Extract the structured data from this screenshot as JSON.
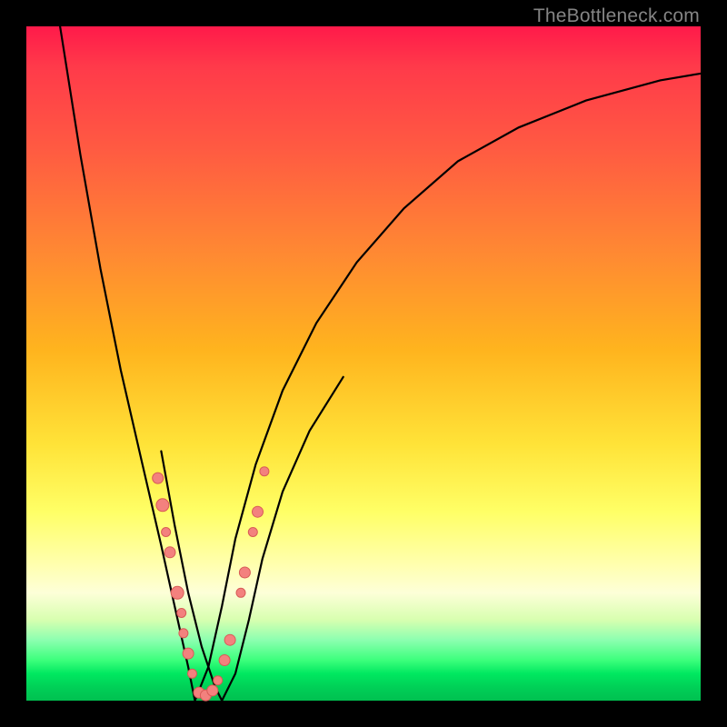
{
  "watermark": "TheBottleneck.com",
  "colors": {
    "border": "#000000",
    "curve": "#000000",
    "dot_fill": "#f3817e",
    "dot_stroke": "#d85b56"
  },
  "chart_data": {
    "type": "line",
    "title": "",
    "xlabel": "",
    "ylabel": "",
    "xlim": [
      0,
      100
    ],
    "ylim": [
      0,
      100
    ],
    "note": "Two V-shaped bottleneck curves on a red-to-green vertical gradient. Minima near x≈25 (main curve) and x≈29 (secondary curve). Axis values are estimated from pixel positions; the image has no tick labels.",
    "series": [
      {
        "name": "curve-main",
        "x": [
          5,
          8,
          11,
          14,
          17,
          20,
          22,
          24,
          25,
          27,
          29,
          31,
          34,
          38,
          43,
          49,
          56,
          64,
          73,
          83,
          94,
          100
        ],
        "y": [
          100,
          81,
          64,
          49,
          36,
          23,
          14,
          5,
          0,
          5,
          14,
          24,
          35,
          46,
          56,
          65,
          73,
          80,
          85,
          89,
          92,
          93
        ]
      },
      {
        "name": "curve-secondary",
        "x": [
          20,
          22,
          24,
          26,
          28,
          29,
          31,
          33,
          35,
          38,
          42,
          47
        ],
        "y": [
          37,
          26,
          16,
          8,
          2,
          0,
          4,
          12,
          21,
          31,
          40,
          48
        ]
      }
    ],
    "scatter": {
      "name": "dots",
      "points": [
        {
          "x": 19.5,
          "y": 33,
          "r": 6
        },
        {
          "x": 20.2,
          "y": 29,
          "r": 7
        },
        {
          "x": 20.7,
          "y": 25,
          "r": 5
        },
        {
          "x": 21.3,
          "y": 22,
          "r": 6
        },
        {
          "x": 22.4,
          "y": 16,
          "r": 7
        },
        {
          "x": 23.0,
          "y": 13,
          "r": 5
        },
        {
          "x": 23.3,
          "y": 10,
          "r": 5
        },
        {
          "x": 24.0,
          "y": 7,
          "r": 6
        },
        {
          "x": 24.6,
          "y": 4,
          "r": 5
        },
        {
          "x": 25.6,
          "y": 1.2,
          "r": 6
        },
        {
          "x": 26.6,
          "y": 0.8,
          "r": 6
        },
        {
          "x": 27.6,
          "y": 1.5,
          "r": 6
        },
        {
          "x": 28.4,
          "y": 3,
          "r": 5
        },
        {
          "x": 29.4,
          "y": 6,
          "r": 6
        },
        {
          "x": 30.2,
          "y": 9,
          "r": 6
        },
        {
          "x": 31.8,
          "y": 16,
          "r": 5
        },
        {
          "x": 32.4,
          "y": 19,
          "r": 6
        },
        {
          "x": 33.6,
          "y": 25,
          "r": 5
        },
        {
          "x": 34.3,
          "y": 28,
          "r": 6
        },
        {
          "x": 35.3,
          "y": 34,
          "r": 5
        }
      ]
    }
  }
}
